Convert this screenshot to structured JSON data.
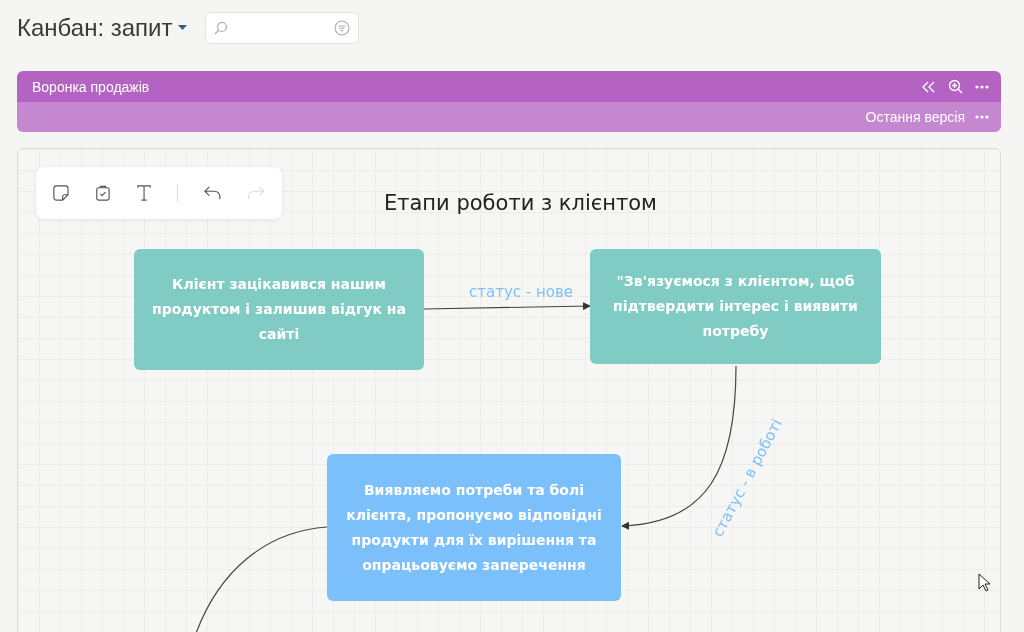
{
  "header": {
    "title": "Канбан: запит"
  },
  "pipeline": {
    "title": "Воронка продажів",
    "version": "Остання версія"
  },
  "board": {
    "title": "Етапи роботи з клієнтом",
    "nodes": [
      {
        "text": "Клієнт зацікавився нашим продуктом і залишив відгук на сайті",
        "color": "#80cbc4"
      },
      {
        "text": "\"Зв'язуємося з клієнтом, щоб підтвердити інтерес і виявити потребу",
        "color": "#80cbc4"
      },
      {
        "text": "Виявляємо потреби та болі клієнта, пропонуємо відповідні продукти для їх вирішення та опрацьовуємо заперечення",
        "color": "#7cc0fb"
      }
    ],
    "edge_labels": [
      "статус - нове",
      "статус - в роботі"
    ]
  }
}
